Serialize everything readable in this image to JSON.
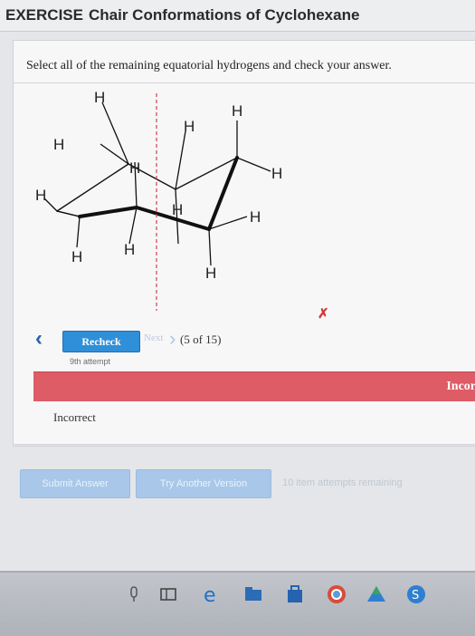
{
  "header": {
    "prefix": "EXERCISE",
    "title": "Chair Conformations of Cyclohexane"
  },
  "question": "Select all of the remaining equatorial hydrogens and check your answer.",
  "diagram": {
    "h_label": "H"
  },
  "nav": {
    "recheck_label": "Recheck",
    "next_label": "Next",
    "progress": "(5 of 15)",
    "attempt": "9th attempt"
  },
  "feedback": {
    "result_mark": "✗",
    "banner_text": "Incor",
    "message": "Incorrect"
  },
  "actions": {
    "submit_label": "Submit Answer",
    "try_another_label": "Try Another Version",
    "remaining": "10 item attempts remaining"
  },
  "colors": {
    "accent": "#2f8fd8",
    "incorrect_banner": "#dd5c66",
    "incorrect_mark": "#d23a3a"
  },
  "taskbar": {
    "icons": [
      "microphone-icon",
      "task-view-icon",
      "edge-icon",
      "file-explorer-icon",
      "store-icon",
      "chrome-icon",
      "drive-icon",
      "app-icon"
    ]
  }
}
